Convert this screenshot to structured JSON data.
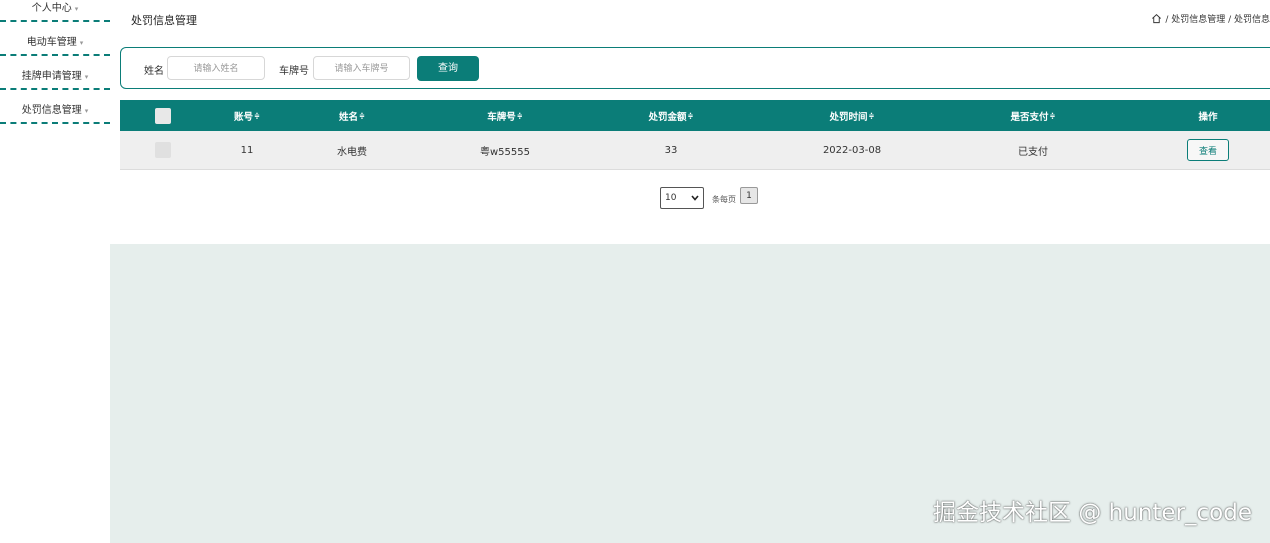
{
  "sidebar": {
    "items": [
      {
        "label": "个人中心"
      },
      {
        "label": "电动车管理"
      },
      {
        "label": "挂牌申请管理"
      },
      {
        "label": "处罚信息管理"
      }
    ],
    "caret": "▾"
  },
  "header": {
    "title": "处罚信息管理",
    "breadcrumb": "/ 处罚信息管理 / 处罚信息"
  },
  "search": {
    "name_label": "姓名",
    "name_placeholder": "请输入姓名",
    "plate_label": "车牌号",
    "plate_placeholder": "请输入车牌号",
    "button_label": "查询"
  },
  "table": {
    "columns": [
      "账号",
      "姓名",
      "车牌号",
      "处罚金额",
      "处罚时间",
      "是否支付",
      "操作"
    ],
    "sort_icon": "≑",
    "rows": [
      {
        "account": "11",
        "name": "水电费",
        "plate": "粤w55555",
        "amount": "33",
        "time": "2022-03-08",
        "paid": "已支付",
        "action": "查看"
      }
    ]
  },
  "pagination": {
    "page_size": "10",
    "per_page_label": "条每页",
    "current_page": "1"
  },
  "watermark": "掘金技术社区 @ hunter_code",
  "colors": {
    "accent": "#0b7d78",
    "panel_bg": "#e6eeec"
  }
}
